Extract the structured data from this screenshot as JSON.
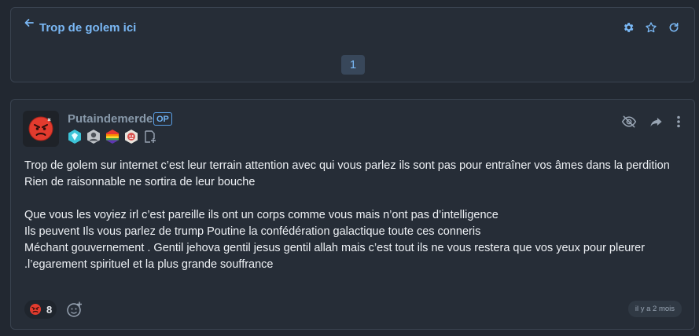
{
  "topic": {
    "title": "Trop de golem ici",
    "current_page": "1",
    "actions": [
      "gear-icon",
      "star-icon",
      "refresh-icon"
    ]
  },
  "post": {
    "username": "Putaindemerde",
    "op_label": "OP",
    "avatar_icon": "angry-face-icon",
    "badges": [
      "diamond-badge",
      "portrait-badge",
      "rainbow-badge",
      "mascot-badge",
      "add-badge-icon"
    ],
    "actions": [
      "hide-icon",
      "share-icon",
      "more-icon"
    ],
    "body": [
      "Trop de golem sur internet c’est leur terrain attention avec qui vous parlez ils sont pas pour entraîner vos âmes dans la perdition",
      "Rien de raisonnable ne sortira de leur bouche",
      "",
      "Que vous les voyiez irl c’est pareille ils ont un corps comme vous mais n’ont pas d’intelligence",
      "Ils peuvent Ils vous parlez de trump Poutine la confédération galactique toute ces conneris",
      "Méchant gouvernement . Gentil jehova gentil jesus gentil allah mais c’est tout ils ne vous restera que vos yeux pour pleurer .l’egarement spirituel et la plus grande souffrance"
    ],
    "reaction": {
      "icon": "angry-face-icon",
      "count": "8"
    },
    "timestamp": "il y a 2 mois"
  },
  "colors": {
    "background": "#222831",
    "card": "#262d37",
    "accent": "#7ab8f5",
    "username": "#8899aa"
  }
}
